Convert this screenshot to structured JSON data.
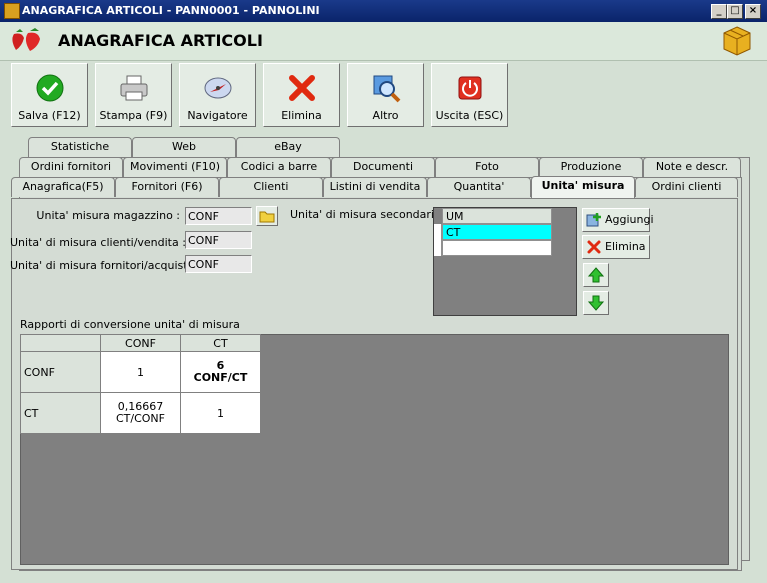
{
  "window": {
    "title": "ANAGRAFICA ARTICOLI - PANN0001 - PANNOLINI",
    "min": "_",
    "max": "□",
    "close": "×"
  },
  "header": {
    "title": "ANAGRAFICA ARTICOLI"
  },
  "toolbar": {
    "save": "Salva (F12)",
    "print": "Stampa (F9)",
    "navigator": "Navigatore",
    "delete": "Elimina",
    "other": "Altro",
    "exit": "Uscita (ESC)"
  },
  "tabs": {
    "row1": [
      "Statistiche",
      "Web",
      "eBay"
    ],
    "row2": [
      "Ordini fornitori",
      "Movimenti (F10)",
      "Codici a barre",
      "Documenti",
      "Foto",
      "Produzione",
      "Note e descr."
    ],
    "row3": [
      "Anagrafica(F5)",
      "Fornitori (F6)",
      "Clienti",
      "Listini di vendita",
      "Quantita'",
      "Unita' misura",
      "Ordini clienti"
    ]
  },
  "form": {
    "um_magazzino_label": "Unita' misura magazzino :",
    "um_magazzino_value": "CONF",
    "um_clienti_label": "Unita' di misura clienti/vendita :",
    "um_clienti_value": "CONF",
    "um_fornitori_label": "Unita' di misura fornitori/acquisto :",
    "um_fornitori_value": "CONF",
    "um_secondarie_label": "Unita' di misura secondarie :"
  },
  "secondary_list": {
    "header": "UM",
    "rows": [
      "CT",
      ""
    ],
    "selected_color": "#00ffff"
  },
  "side_buttons": {
    "add": "Aggiungi",
    "delete": "Elimina"
  },
  "conversion": {
    "caption": "Rapporti di conversione unita' di misura",
    "columns": [
      "CONF",
      "CT"
    ],
    "rows": [
      {
        "label": "CONF",
        "cells": [
          "1",
          "6\nCONF/CT"
        ]
      },
      {
        "label": "CT",
        "cells": [
          "0,16667\nCT/CONF",
          "1"
        ]
      }
    ]
  },
  "colors": {
    "titlebar": "#0a246a",
    "background": "#d4e0d4",
    "selection": "#00ffff"
  }
}
